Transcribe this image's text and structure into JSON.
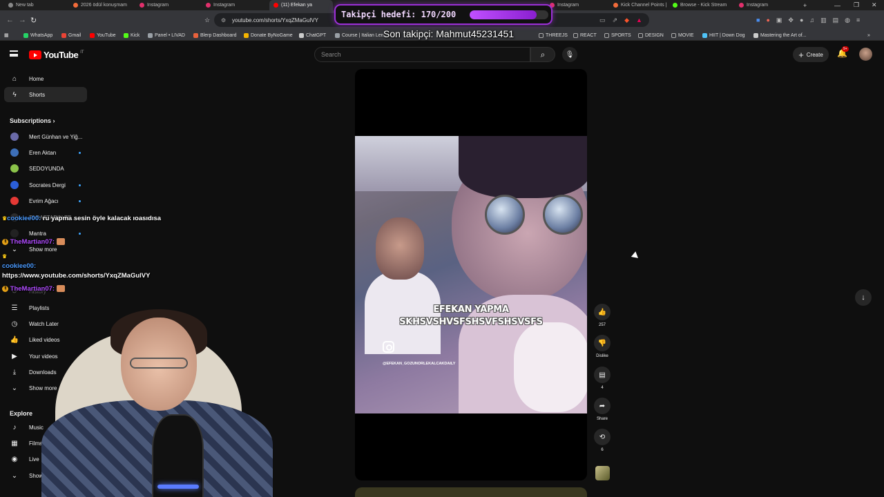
{
  "browser": {
    "tabs": [
      {
        "label": "New tab",
        "color": "#888888"
      },
      {
        "label": "2026 ödül konuşmam",
        "color": "#f26b3a"
      },
      {
        "label": "Instagram",
        "color": "#e1306c"
      },
      {
        "label": "Instagram",
        "color": "#e1306c"
      },
      {
        "label": "(11) Efekan ya",
        "color": "#ff0000"
      },
      {
        "label": "Instagram",
        "color": "#e1306c"
      },
      {
        "label": "Kick Channel Points |",
        "color": "#f26b3a"
      },
      {
        "label": "Browse - Kick Stream",
        "color": "#53fc18"
      },
      {
        "label": "Instagram",
        "color": "#e1306c"
      }
    ],
    "new_tab_label": "+",
    "window_controls": [
      "—",
      "❐",
      "✕"
    ],
    "url": "youtube.com/shorts/YxqZMaGulVY",
    "bookmarks": [
      {
        "label": "WhatsApp",
        "color": "#25d366"
      },
      {
        "label": "Gmail",
        "color": "#ea4335"
      },
      {
        "label": "YouTube",
        "color": "#ff0000"
      },
      {
        "label": "Kick",
        "color": "#53fc18"
      },
      {
        "label": "Panel • LIVAD",
        "color": "#9aa0a6"
      },
      {
        "label": "Blerp Dashboard",
        "color": "#e8613c"
      },
      {
        "label": "Donate ByNoGame",
        "color": "#f4b400"
      },
      {
        "label": "ChatGPT",
        "color": "#cccccc"
      },
      {
        "label": "Course | Italian Len...",
        "color": "#9aa0a6"
      },
      {
        "label": "THREEJS",
        "color": "#9aa0a6"
      },
      {
        "label": "REACT",
        "color": "#9aa0a6"
      },
      {
        "label": "SPORTS",
        "color": "#9aa0a6"
      },
      {
        "label": "DESIGN",
        "color": "#9aa0a6"
      },
      {
        "label": "MOVIE",
        "color": "#9aa0a6"
      },
      {
        "label": "HIIT | Down Dog",
        "color": "#4fc3f7"
      },
      {
        "label": "Mastering the Art of...",
        "color": "#cccccc"
      }
    ],
    "bookmarks_more": "»"
  },
  "stream_overlay": {
    "goal_text": "Takipçi hedefi: 170/200",
    "goal_current": 170,
    "goal_target": 200,
    "last_follower": "Son takipçi: Mahmut45231451"
  },
  "youtube": {
    "logo_text": "YouTube",
    "country_code": "IT",
    "search_placeholder": "Search",
    "create_label": "Create",
    "notif_badge": "9+",
    "sidebar": {
      "main": [
        {
          "label": "Home",
          "icon": "home-icon",
          "glyph": "⌂"
        },
        {
          "label": "Shorts",
          "icon": "shorts-icon",
          "glyph": "ϟ"
        }
      ],
      "subscriptions_title": "Subscriptions",
      "subscriptions": [
        {
          "label": "Mert Günhan ve Yiğ...",
          "color": "#6a6aa8",
          "dot": false
        },
        {
          "label": "Eren Aktan",
          "color": "#3d6fb8",
          "dot": true
        },
        {
          "label": "SEDOYUNDA",
          "color": "#8bc34a",
          "dot": false
        },
        {
          "label": "Socrates Dergi",
          "color": "#2b5fd9",
          "dot": true
        },
        {
          "label": "Evrim Ağacı",
          "color": "#e53935",
          "dot": true
        },
        {
          "label": "TARAFTARIN TE...",
          "color": "#444444",
          "dot": false
        },
        {
          "label": "Mantra",
          "color": "#222222",
          "dot": true
        }
      ],
      "show_more": "Show more",
      "you": [
        {
          "label": "History",
          "glyph": "↺",
          "icon": "history-icon"
        },
        {
          "label": "Playlists",
          "glyph": "☰",
          "icon": "playlists-icon"
        },
        {
          "label": "Watch Later",
          "glyph": "◷",
          "icon": "watch-later-icon"
        },
        {
          "label": "Liked videos",
          "glyph": "👍",
          "icon": "like-icon"
        },
        {
          "label": "Your videos",
          "glyph": "▶",
          "icon": "your-videos-icon"
        },
        {
          "label": "Downloads",
          "glyph": "⤓",
          "icon": "download-icon"
        }
      ],
      "show_more_2": "Show more",
      "explore_title": "Explore",
      "explore": [
        {
          "label": "Music",
          "glyph": "♪",
          "icon": "music-icon"
        },
        {
          "label": "Films",
          "glyph": "▦",
          "icon": "films-icon"
        },
        {
          "label": "Live",
          "glyph": "◉",
          "icon": "live-icon"
        },
        {
          "label": "Show",
          "glyph": "⌄",
          "icon": "chevron-down-icon"
        }
      ]
    },
    "short": {
      "caption_line1": "EFEKAN YAPMA",
      "caption_line2": "SKHSVSHVSFSHSVFSHSVSFS",
      "handle": "@EFEKAN_GOZUNORLEKALCAKDAILY"
    },
    "actions": {
      "like_count": "257",
      "dislike_label": "Dislike",
      "comment_count": "4",
      "share_label": "Share",
      "remix_count": "6"
    }
  },
  "chat": [
    {
      "user": "cookiee00:",
      "text": "ru yapma sesin öyle kalacak ıoasıdısa",
      "badge": "crown"
    },
    {
      "user": "TheMartian07:",
      "text": "",
      "badge": "emote"
    },
    {
      "user": "cookiee00:",
      "text": "https://www.youtube.com/shorts/YxqZMaGulVY",
      "badge": "crown"
    },
    {
      "user": "TheMartian07:",
      "text": "",
      "badge": "emote"
    }
  ]
}
